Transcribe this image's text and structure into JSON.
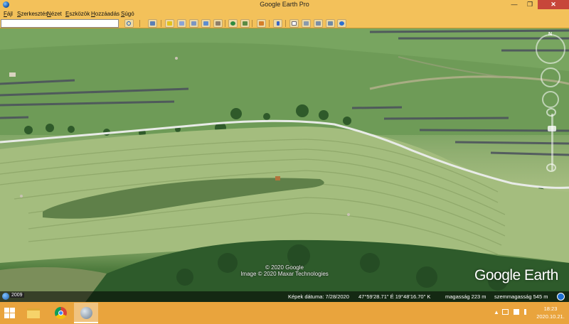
{
  "window": {
    "title": "Google Earth Pro",
    "minimize_glyph": "—",
    "restore_glyph": "❐",
    "close_glyph": "✕"
  },
  "menu": [
    "Fájl",
    "Szerkesztés",
    "Nézet",
    "Eszközök",
    "Hozzáadás",
    "Súgó"
  ],
  "search": {
    "value": "",
    "placeholder": ""
  },
  "toolbar": {
    "icons": [
      "search-icon",
      "sidebar-toggle-icon",
      "placemark-icon",
      "polygon-icon",
      "path-icon",
      "image-overlay-icon",
      "tour-icon",
      "historical-imagery-icon",
      "sunlight-icon",
      "planets-icon",
      "ruler-icon",
      "email-icon",
      "print-icon",
      "save-image-icon",
      "maps-icon"
    ]
  },
  "map": {
    "attribution_line1": "© 2020 Google",
    "attribution_line2": "Image © 2020 Maxar Technologies",
    "logo_text": "Google Earth",
    "north_label": "N"
  },
  "statusbar": {
    "year": "2009",
    "image_date": "Képek dátuma: 7/28/2020",
    "coords": "47°59'28.71\" É   19°48'16.70\" K",
    "elevation": "magasság   223 m",
    "eye_alt": "szemmagasság   545 m"
  },
  "taskbar": {
    "apps": [
      "file-explorer-icon",
      "chrome-icon",
      "google-earth-icon"
    ],
    "tray_arrow": "▲",
    "clock_time": "18:23",
    "clock_date": "2020.10.21."
  },
  "colors": {
    "accent": "#f3c15a",
    "taskbar": "#e9a43d",
    "close": "#c7463a"
  }
}
